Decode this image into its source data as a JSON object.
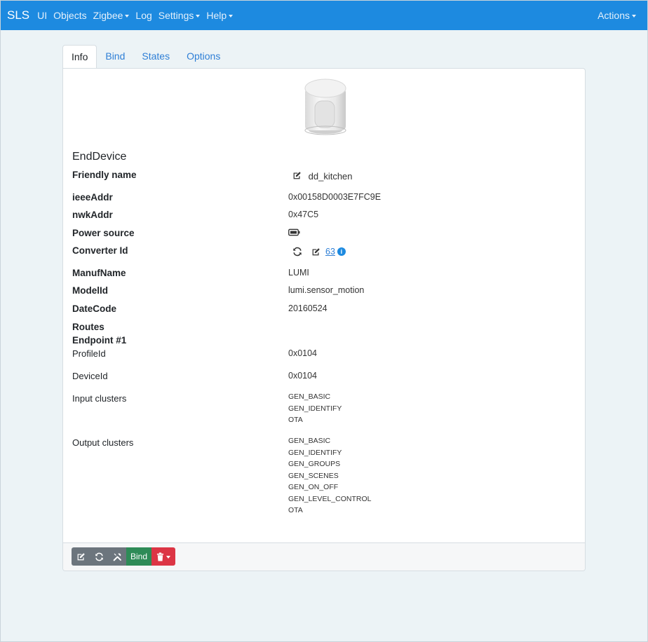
{
  "navbar": {
    "brand": "SLS",
    "items": [
      {
        "label": "UI",
        "dropdown": false
      },
      {
        "label": "Objects",
        "dropdown": false
      },
      {
        "label": "Zigbee",
        "dropdown": true
      },
      {
        "label": "Log",
        "dropdown": false
      },
      {
        "label": "Settings",
        "dropdown": true
      },
      {
        "label": "Help",
        "dropdown": true
      }
    ],
    "actions_label": "Actions"
  },
  "tabs": [
    "Info",
    "Bind",
    "States",
    "Options"
  ],
  "device": {
    "type": "EndDevice",
    "fields": {
      "friendly_name_label": "Friendly name",
      "friendly_name": "dd_kitchen",
      "ieee_label": "ieeeAddr",
      "ieee": "0x00158D0003E7FC9E",
      "nwk_label": "nwkAddr",
      "nwk": "0x47C5",
      "power_label": "Power source",
      "power_icon": "battery-icon",
      "converter_label": "Converter Id",
      "converter_id": "63",
      "manuf_label": "ManufName",
      "manuf": "LUMI",
      "model_label": "ModelId",
      "model": "lumi.sensor_motion",
      "datecode_label": "DateCode",
      "datecode": "20160524",
      "routes_label": "Routes"
    },
    "endpoint": {
      "title": "Endpoint #1",
      "profile_label": "ProfileId",
      "profile": "0x0104",
      "device_label": "DeviceId",
      "device": "0x0104",
      "input_label": "Input clusters",
      "input_clusters": [
        "GEN_BASIC",
        "GEN_IDENTIFY",
        "OTA"
      ],
      "output_label": "Output clusters",
      "output_clusters": [
        "GEN_BASIC",
        "GEN_IDENTIFY",
        "GEN_GROUPS",
        "GEN_SCENES",
        "GEN_ON_OFF",
        "GEN_LEVEL_CONTROL",
        "OTA"
      ]
    }
  },
  "footer": {
    "bind_label": "Bind"
  },
  "colors": {
    "navbar": "#1d8ae0",
    "background": "#ecf3f6",
    "link": "#2f7fd6",
    "btn_gray": "#6c757d",
    "btn_green": "#2e8b57",
    "btn_red": "#dc3545"
  }
}
